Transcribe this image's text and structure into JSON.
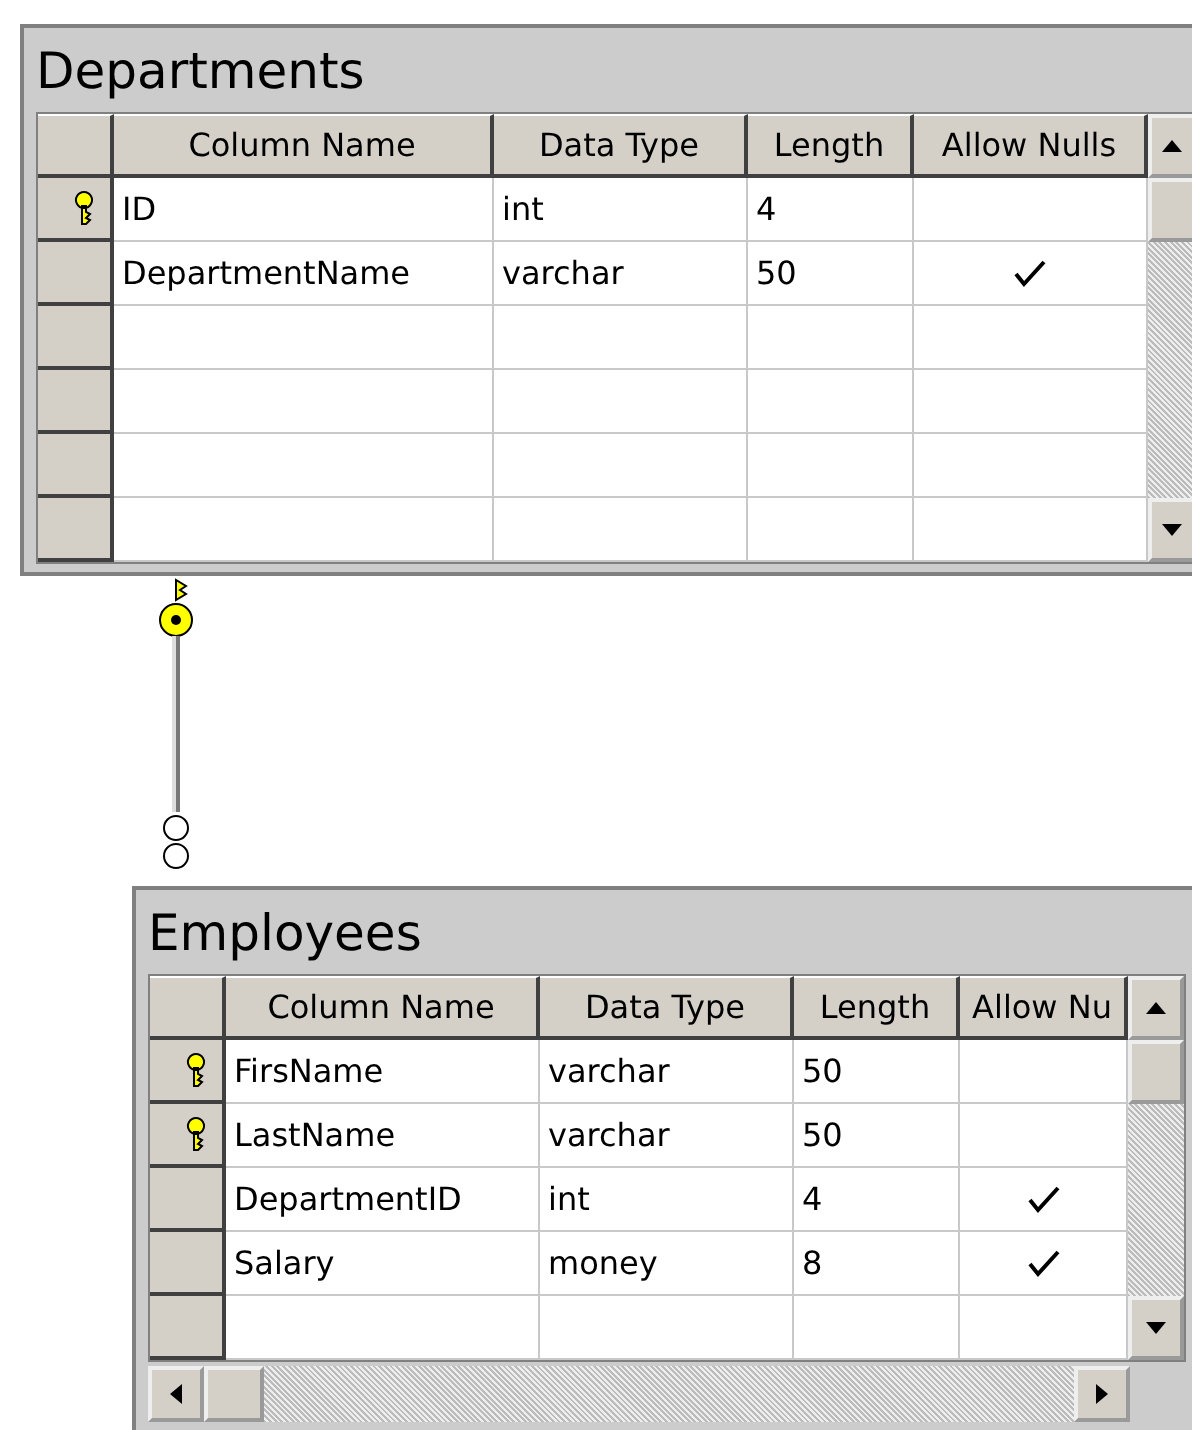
{
  "tables": [
    {
      "title": "Departments",
      "horizontal_scrollbar": false,
      "columns": [
        "Column Name",
        "Data Type",
        "Length",
        "Allow Nulls"
      ],
      "rows": [
        {
          "kind": "field",
          "primary_key": true,
          "name": "ID",
          "type": "int",
          "length": "4",
          "allow_nulls": false
        },
        {
          "kind": "field",
          "primary_key": false,
          "name": "DepartmentName",
          "type": "varchar",
          "length": "50",
          "allow_nulls": true
        },
        {
          "kind": "blank"
        },
        {
          "kind": "blank"
        },
        {
          "kind": "blank"
        },
        {
          "kind": "blank"
        }
      ]
    },
    {
      "title": "Employees",
      "horizontal_scrollbar": true,
      "columns": [
        "Column Name",
        "Data Type",
        "Length",
        "Allow Nu"
      ],
      "rows": [
        {
          "kind": "field",
          "primary_key": true,
          "name": "FirsName",
          "type": "varchar",
          "length": "50",
          "allow_nulls": false
        },
        {
          "kind": "field",
          "primary_key": true,
          "name": "LastName",
          "type": "varchar",
          "length": "50",
          "allow_nulls": false
        },
        {
          "kind": "field",
          "primary_key": false,
          "name": "DepartmentID",
          "type": "int",
          "length": "4",
          "allow_nulls": true
        },
        {
          "kind": "field",
          "primary_key": false,
          "name": "Salary",
          "type": "money",
          "length": "8",
          "allow_nulls": true
        },
        {
          "kind": "blank"
        }
      ]
    }
  ]
}
